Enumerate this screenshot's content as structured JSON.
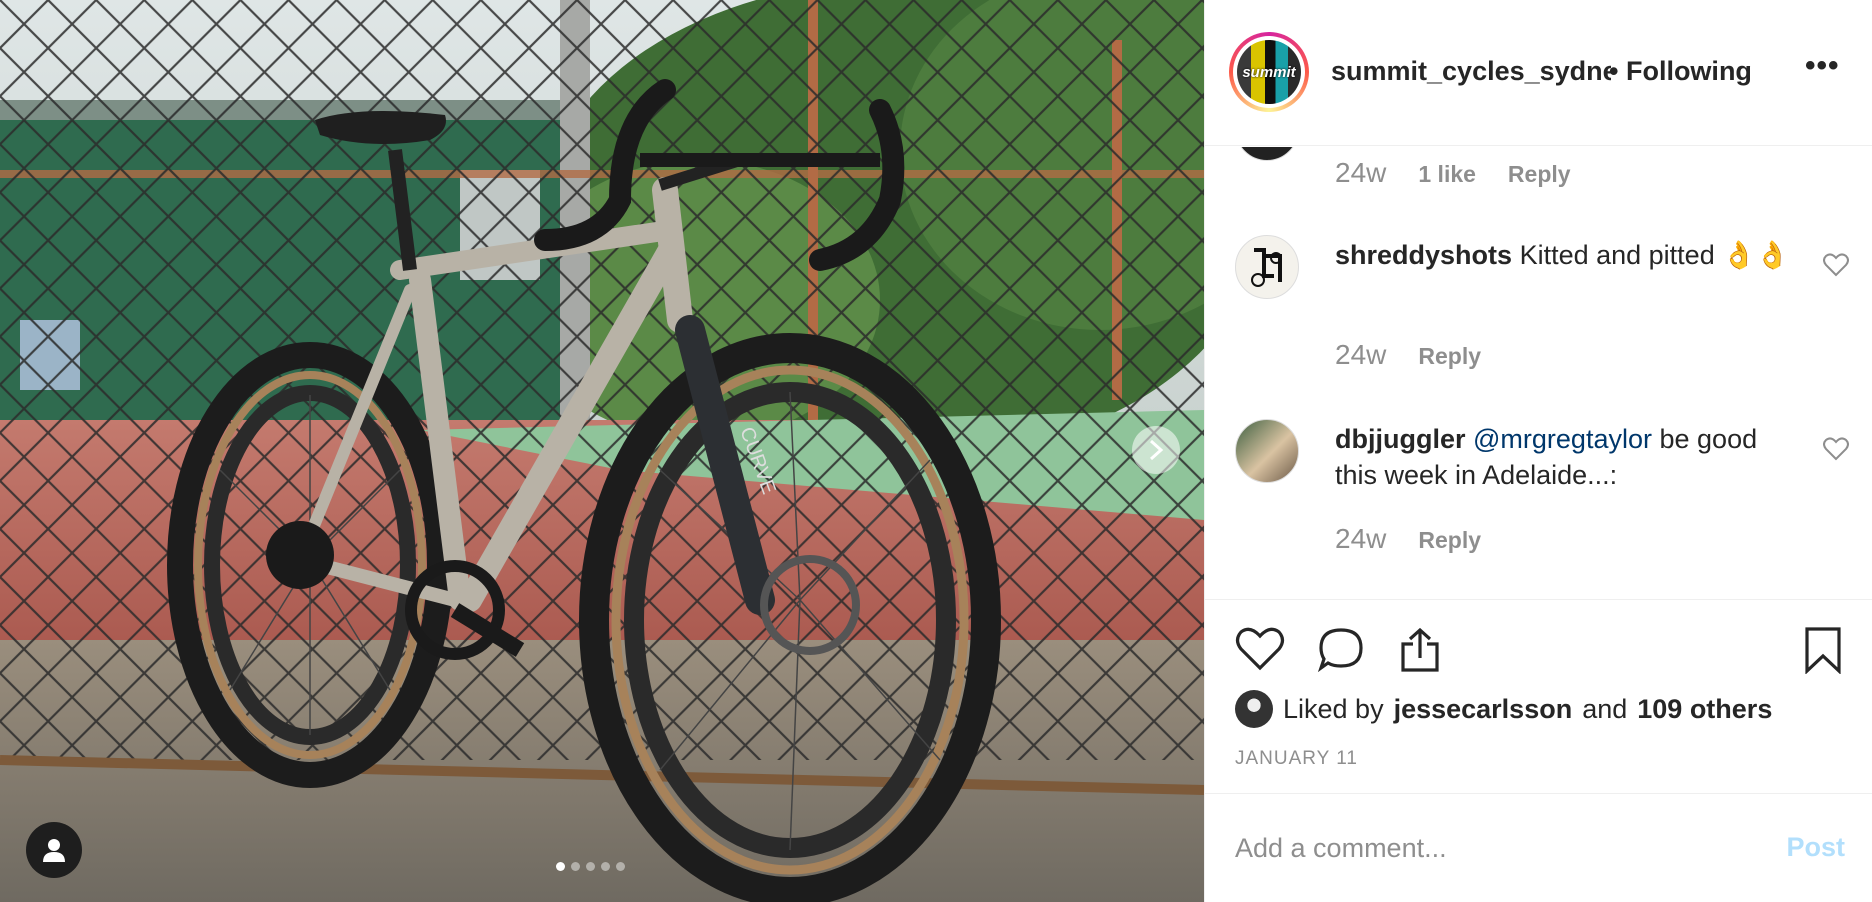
{
  "post": {
    "image_alt": "Titanium gravel bike leaning against a chain-link fence",
    "carousel_dots": 5,
    "active_dot": 0
  },
  "header": {
    "username": "summit_cycles_sydney",
    "following_label": "• Following",
    "avatar_text": "summit"
  },
  "comments": [
    {
      "time": "24w",
      "likes": "1 like",
      "reply": "Reply"
    },
    {
      "username": "shreddyshots",
      "text": "Kitted and pitted 👌👌",
      "time": "24w",
      "reply": "Reply"
    },
    {
      "username": "dbjjuggler",
      "mention": "@mrgregtaylor",
      "text": "be good this week in Adelaide...:",
      "time": "24w",
      "reply": "Reply"
    }
  ],
  "likes": {
    "prefix": "Liked by",
    "user": "jessecarlsson",
    "joiner": "and",
    "others": "109 others"
  },
  "date": "JANUARY 11",
  "add_comment": {
    "placeholder": "Add a comment...",
    "post_label": "Post"
  },
  "colors": {
    "link": "#00376b",
    "muted": "#8e8e8e",
    "post_disabled": "#b2dffc"
  }
}
